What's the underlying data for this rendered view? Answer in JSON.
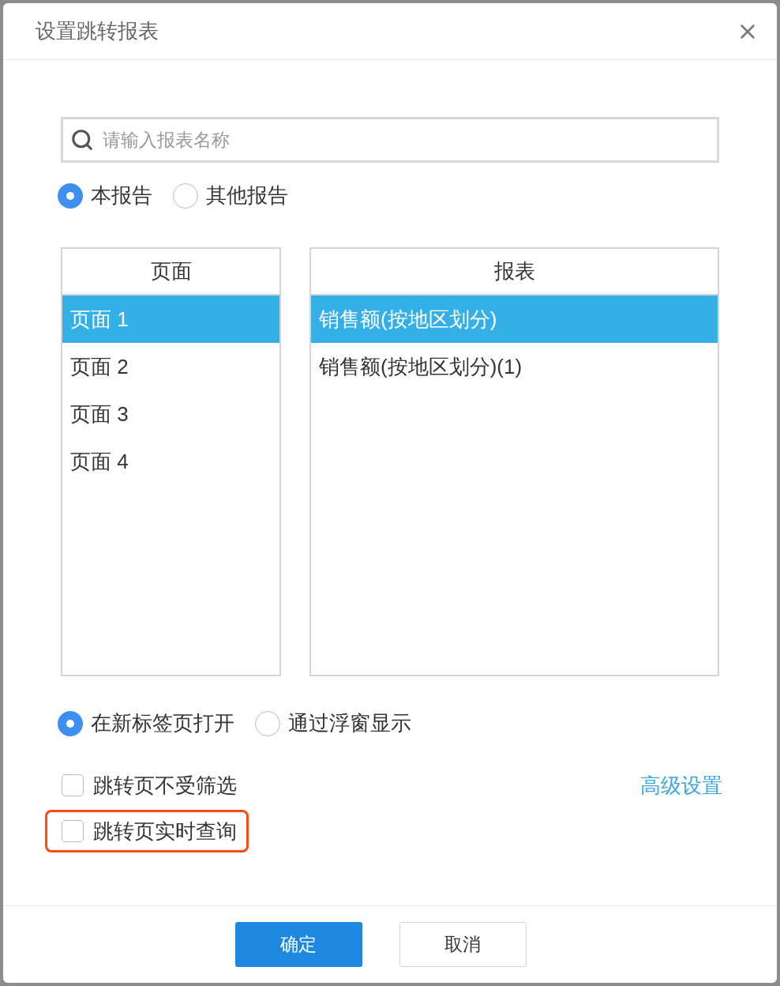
{
  "dialog": {
    "title": "设置跳转报表"
  },
  "search": {
    "placeholder": "请输入报表名称"
  },
  "scope_options": [
    {
      "label": "本报告",
      "selected": true
    },
    {
      "label": "其他报告",
      "selected": false
    }
  ],
  "pages": {
    "header": "页面",
    "items": [
      {
        "label": "页面 1",
        "selected": true
      },
      {
        "label": "页面 2",
        "selected": false
      },
      {
        "label": "页面 3",
        "selected": false
      },
      {
        "label": "页面 4",
        "selected": false
      }
    ]
  },
  "reports": {
    "header": "报表",
    "items": [
      {
        "label": "销售额(按地区划分)",
        "selected": true
      },
      {
        "label": "销售额(按地区划分)(1)",
        "selected": false
      }
    ]
  },
  "open_options": [
    {
      "label": "在新标签页打开",
      "selected": true
    },
    {
      "label": "通过浮窗显示",
      "selected": false
    }
  ],
  "checkboxes": [
    {
      "label": "跳转页不受筛选",
      "checked": false,
      "highlighted": false
    },
    {
      "label": "跳转页实时查询",
      "checked": false,
      "highlighted": true
    }
  ],
  "advanced_link": "高级设置",
  "buttons": [
    {
      "label": "确定",
      "kind": "primary"
    },
    {
      "label": "取消",
      "kind": "secondary"
    }
  ]
}
